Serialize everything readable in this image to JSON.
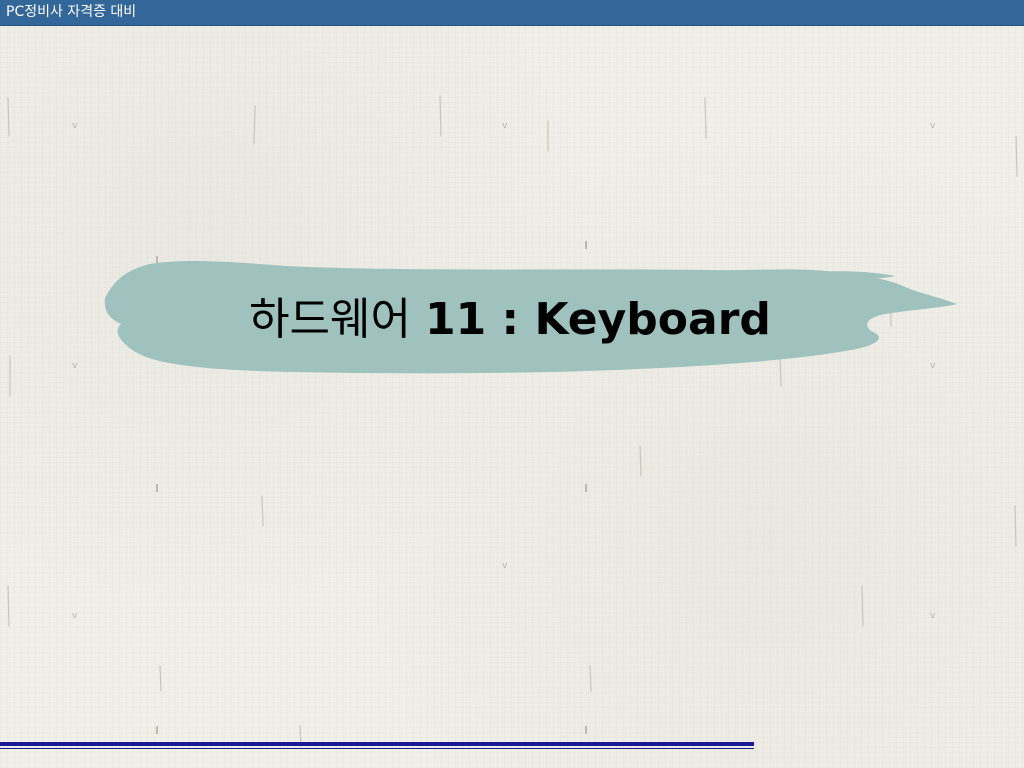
{
  "header": {
    "title": "PC정비사 자격증 대비"
  },
  "slide": {
    "title_prefix": "하드웨어 ",
    "title_main": "11 : Keyboard"
  },
  "colors": {
    "header_bar": "#336699",
    "brush_stroke": "#9fc2bf",
    "footer_rule": "#1a1a99",
    "background": "#f0efe8"
  }
}
